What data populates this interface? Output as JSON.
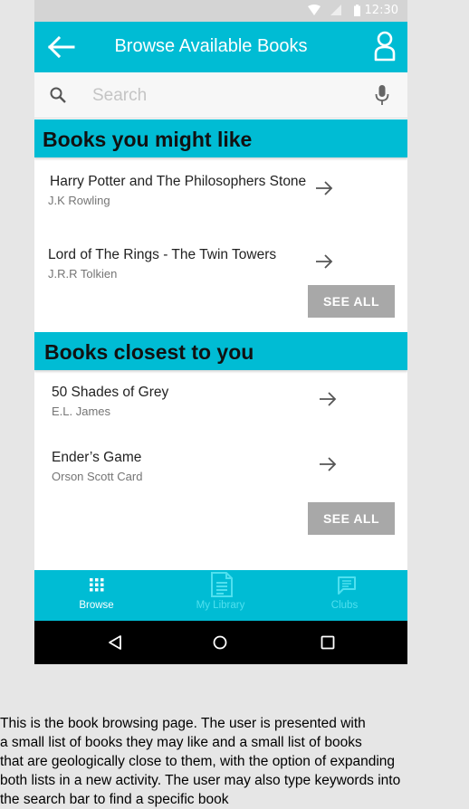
{
  "status_bar": {
    "time": "12:30"
  },
  "app_bar": {
    "title": "Browse Available Books"
  },
  "search": {
    "placeholder": "Search",
    "value": ""
  },
  "sections": {
    "might_like": {
      "title": "Books you might like",
      "books": [
        {
          "title": "Harry Potter and The Philosophers Stone",
          "author": "J.K Rowling"
        },
        {
          "title": "Lord of The Rings - The Twin Towers",
          "author": "J.R.R Tolkien"
        }
      ],
      "see_all": "SEE ALL"
    },
    "closest": {
      "title": "Books closest to you",
      "books": [
        {
          "title": "50 Shades of Grey",
          "author": "E.L. James"
        },
        {
          "title": "Ender’s Game",
          "author": "Orson Scott Card"
        }
      ],
      "see_all": "SEE ALL"
    }
  },
  "bottom_nav": {
    "tabs": [
      {
        "label": "Browse",
        "icon": "grid-icon",
        "active": true
      },
      {
        "label": "My Library",
        "icon": "document-icon",
        "active": false
      },
      {
        "label": "Clubs",
        "icon": "chat-icon",
        "active": false
      }
    ]
  },
  "caption": {
    "lines": [
      "This is the book browsing page. The user is presented with",
      "a small list of books they may like and a small list of books",
      "that are geologically close to them, with the option of expanding",
      "both lists in a new activity. The user may also type keywords into",
      "the search bar to find a specific book"
    ]
  },
  "colors": {
    "accent": "#00bcd4",
    "see_all_bg": "#a8a8a8",
    "status_bar_bg": "#d4d4d4",
    "inactive_tab": "#4fe0ef",
    "page_bg": "#e6e6e6"
  }
}
